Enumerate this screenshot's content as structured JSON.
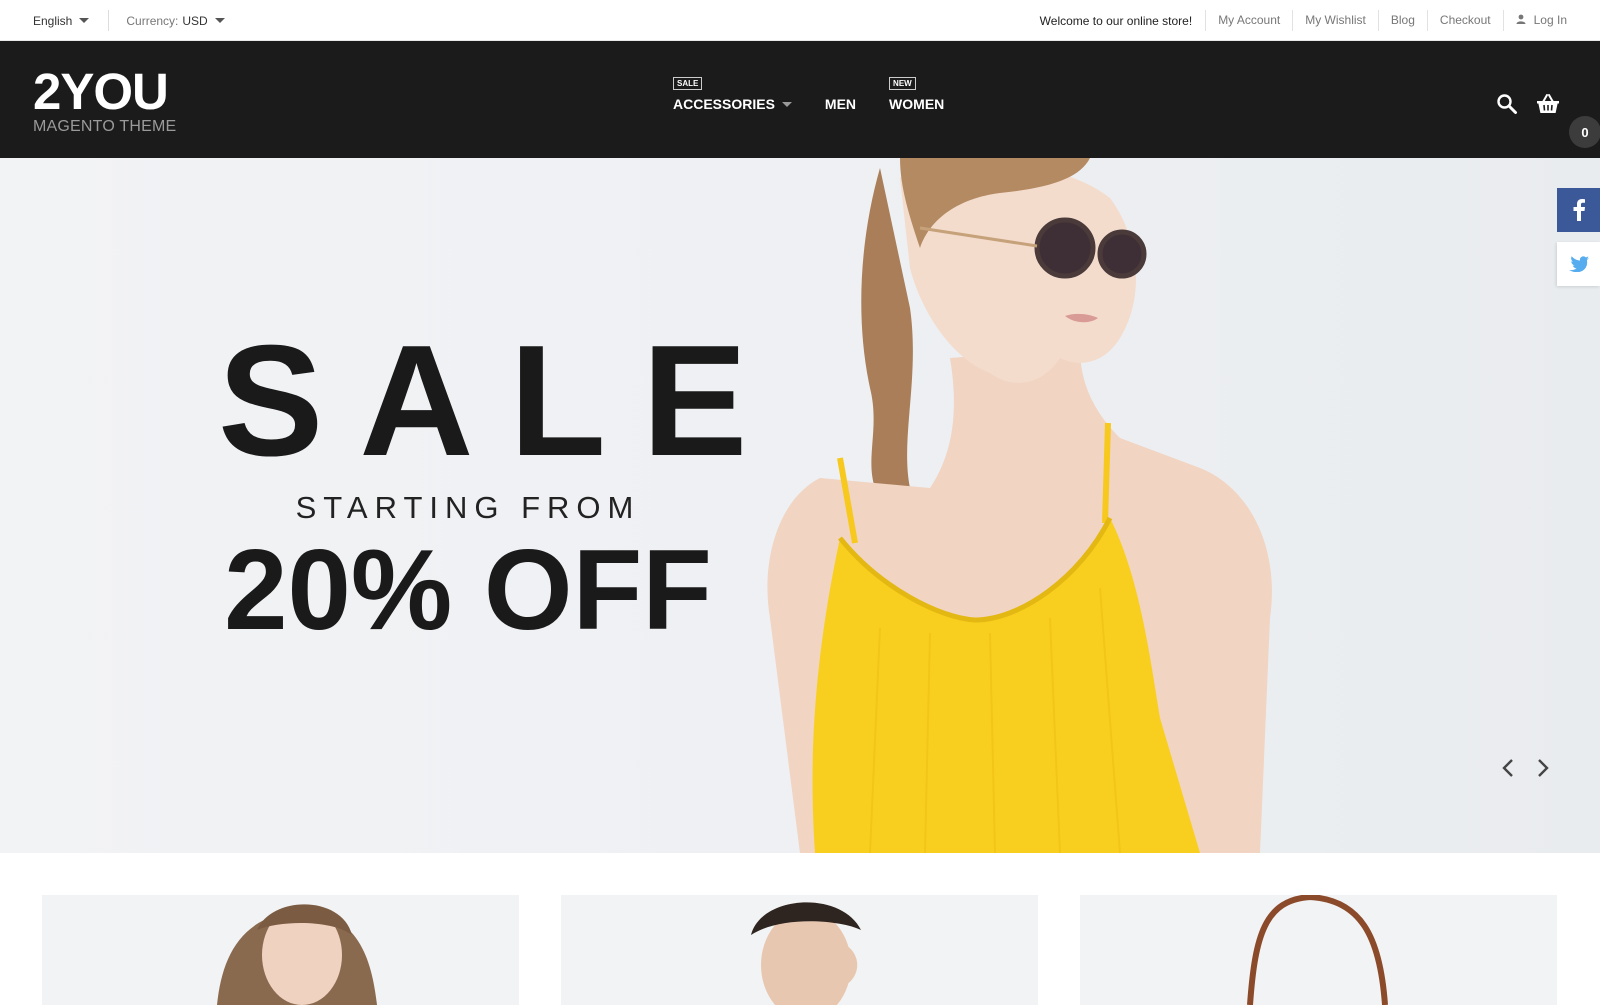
{
  "topbar": {
    "language": "English",
    "currency_label": "Currency:",
    "currency_value": "USD",
    "welcome": "Welcome to our online store!",
    "links": {
      "my_account": "My Account",
      "my_wishlist": "My Wishlist",
      "blog": "Blog",
      "checkout": "Checkout",
      "login": "Log In"
    }
  },
  "header": {
    "logo_main": "2YOU",
    "logo_sub": "MAGENTO THEME",
    "nav": {
      "accessories": {
        "label": "ACCESSORIES",
        "badge": "SALE"
      },
      "men": {
        "label": "MEN"
      },
      "women": {
        "label": "WOMEN",
        "badge": "NEW"
      }
    },
    "cart_count": "0"
  },
  "hero": {
    "headline": "SALE",
    "subline": "STARTING FROM",
    "offer": "20% OFF"
  },
  "colors": {
    "header_bg": "#1b1b1b",
    "facebook": "#3b5998",
    "twitter": "#55acee",
    "dress_yellow": "#f9cf1f"
  },
  "icons": [
    "chevron-down-icon",
    "user-icon",
    "search-icon",
    "cart-icon",
    "chevron-left-icon",
    "chevron-right-icon",
    "facebook-icon",
    "twitter-icon"
  ]
}
